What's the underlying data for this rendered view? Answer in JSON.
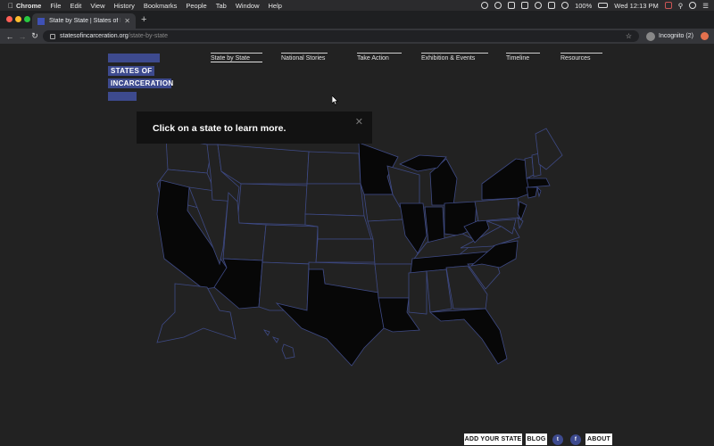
{
  "menubar": {
    "app": "Chrome",
    "items": [
      "File",
      "Edit",
      "View",
      "History",
      "Bookmarks",
      "People",
      "Tab",
      "Window",
      "Help"
    ],
    "battery": "100%",
    "clock": "Wed 12:13 PM"
  },
  "browser": {
    "tab_title": "State by State | States of Incarcer",
    "url_host": "statesofincarceration.org",
    "url_path": "/state-by-state",
    "profile": "Incognito (2)"
  },
  "site": {
    "logo_line1": "STATES OF",
    "logo_line2": "INCARCERATION",
    "nav": [
      "State by State",
      "National Stories",
      "Take Action",
      "Exhibition & Events",
      "Timeline",
      "Resources"
    ],
    "tooltip": "Click on a state to learn more.",
    "footer": {
      "add_state": "ADD YOUR STATE",
      "blog": "BLOG",
      "about": "ABOUT"
    }
  },
  "icons": {
    "twitter": "twitter-icon",
    "facebook": "facebook-icon"
  },
  "colors": {
    "background": "#222222",
    "state_default": "#222222",
    "state_selected": "#070707",
    "border": "#3e4a85",
    "brand": "#3d4a8e"
  }
}
